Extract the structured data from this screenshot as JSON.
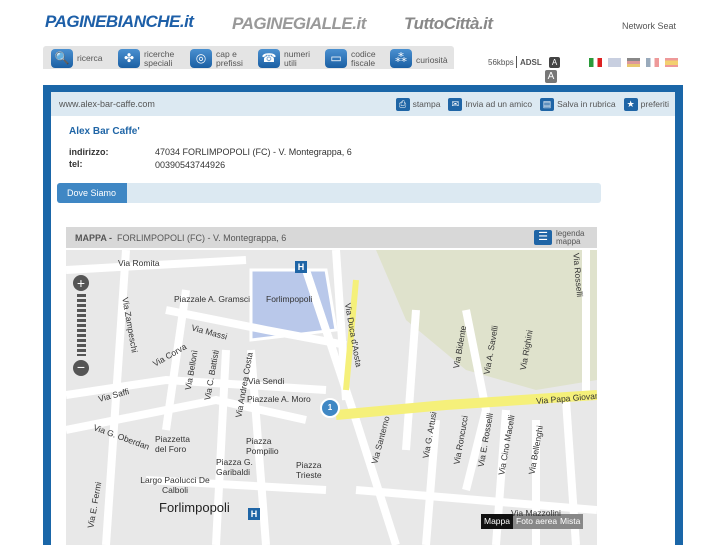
{
  "header": {
    "logos": [
      "PAGINEBIANCHE.it",
      "PAGINEGIALLE.it",
      "TuttoCittà.it"
    ],
    "network": "Network Seat"
  },
  "nav": [
    {
      "icon": "search-icon",
      "label": "ricerca"
    },
    {
      "icon": "clover-icon",
      "label": "ricerche speciali"
    },
    {
      "icon": "globe-icon",
      "label": "cap e prefissi"
    },
    {
      "icon": "phone-icon",
      "label": "numeri utili"
    },
    {
      "icon": "card-icon",
      "label": "codice fiscale"
    },
    {
      "icon": "curiosity-icon",
      "label": "curiosità"
    }
  ],
  "speed": {
    "low": "56kbps",
    "high": "ADSL",
    "a": "A"
  },
  "topbar": {
    "url": "www.alex-bar-caffe.com",
    "actions": [
      "stampa",
      "Invia ad un amico",
      "Salva in rubrica",
      "preferiti"
    ]
  },
  "listing": {
    "name": "Alex Bar Caffe'",
    "address_label": "indirizzo:",
    "address": "47034 FORLIMPOPOLI (FC) - V. Montegrappa, 6",
    "tel_label": "tel:",
    "tel": "00390543744926"
  },
  "tab": "Dove Siamo",
  "map": {
    "title": "MAPPA -",
    "subtitle": "FORLIMPOPOLI (FC) - V. Montegrappa, 6",
    "legend": "legenda mappa",
    "modes": [
      "Mappa",
      "Foto aerea",
      "Mista"
    ],
    "marker": "1",
    "labels": [
      "Via Romita",
      "Piazzale A. Gramsci",
      "Forlimpopoli",
      "Via Zampeschi",
      "Via Massi",
      "Via Corva",
      "Via Bellonì",
      "Via C. Battisti",
      "Via Andrea Costa",
      "Via Sendi",
      "Piazzale A. Moro",
      "Via Saffi",
      "Via G. Oberdan",
      "Piazzetta del Foro",
      "Piazza Pompilio",
      "Piazza G. Garibaldi",
      "Piazza Trieste",
      "Largo Paolucci De Calboli",
      "Forlimpopoli",
      "Via E. Fermi",
      "Via Duca d'Aosta",
      "Via Papa Giovanni",
      "Via Santerno",
      "Via G. Artusi",
      "Via Roncucci",
      "Via E. Rosselli",
      "Via Cino Macelli",
      "Via Bellenghi",
      "Via Mazzolini",
      "Via Bidente",
      "Via A. Savelli",
      "Via Righini",
      "Via Rosselli"
    ]
  }
}
